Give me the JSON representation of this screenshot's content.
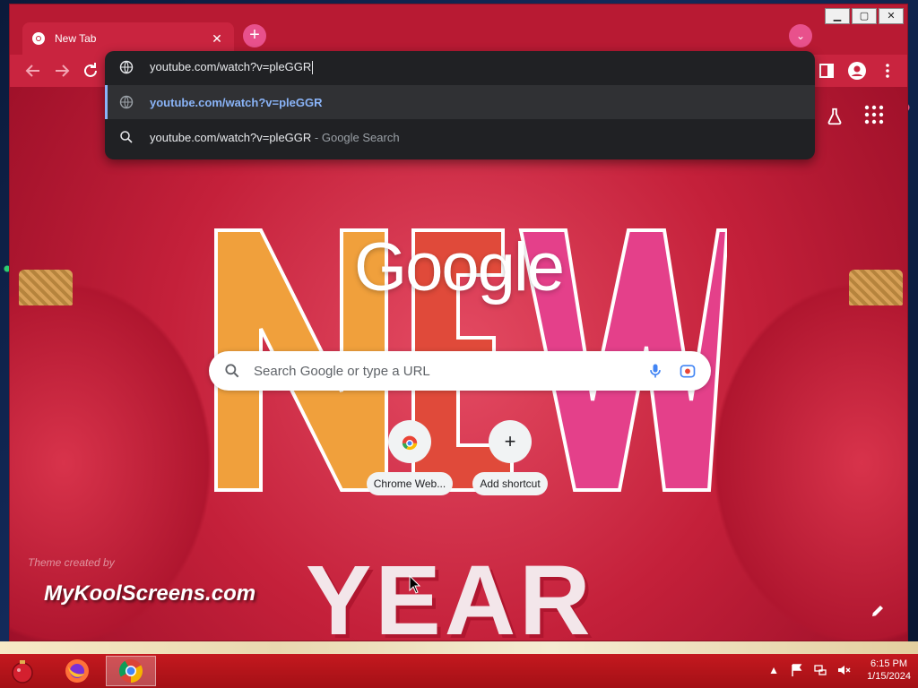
{
  "browser": {
    "tab": {
      "title": "New Tab",
      "close_glyph": "✕"
    },
    "new_tab_glyph": "+",
    "tab_search_glyph": "⌄",
    "window_controls": {
      "minimize": "▁",
      "maximize": "▢",
      "close": "✕"
    }
  },
  "omnibox": {
    "input_text": "youtube.com/watch?v=pleGGR",
    "suggestions": [
      {
        "icon": "globe-icon",
        "url": "youtube.com/watch?v=pleGGR",
        "selected": true
      },
      {
        "icon": "search-icon",
        "text": "youtube.com/watch?v=pleGGR",
        "separator": " - ",
        "suffix": "Google Search"
      }
    ]
  },
  "ntp": {
    "logo": "Google",
    "search_placeholder": "Search Google or type a URL",
    "shortcuts": [
      {
        "label": "Chrome Web...",
        "icon": "chrome-web-store-icon"
      },
      {
        "label": "Add shortcut",
        "icon": "plus-icon",
        "glyph": "+"
      }
    ],
    "theme_credit": "Theme created by",
    "theme_brand": "MyKoolScreens.com",
    "decor_text": "YEAR"
  },
  "taskbar": {
    "time": "6:15 PM",
    "date": "1/15/2024",
    "tray_up_glyph": "▲"
  },
  "colors": {
    "window_red": "#c4203a",
    "omnibox_bg": "#202124",
    "link_blue": "#8ab4f8",
    "accent_pink": "#e8518c"
  }
}
